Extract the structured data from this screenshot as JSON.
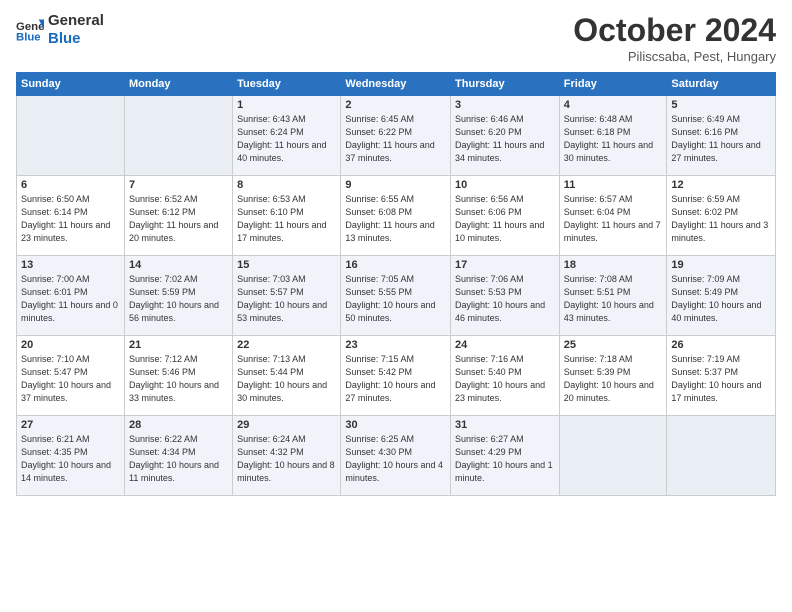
{
  "header": {
    "logo_line1": "General",
    "logo_line2": "Blue",
    "month": "October 2024",
    "location": "Piliscsaba, Pest, Hungary"
  },
  "weekdays": [
    "Sunday",
    "Monday",
    "Tuesday",
    "Wednesday",
    "Thursday",
    "Friday",
    "Saturday"
  ],
  "weeks": [
    [
      {
        "day": "",
        "info": ""
      },
      {
        "day": "",
        "info": ""
      },
      {
        "day": "1",
        "info": "Sunrise: 6:43 AM\nSunset: 6:24 PM\nDaylight: 11 hours and 40 minutes."
      },
      {
        "day": "2",
        "info": "Sunrise: 6:45 AM\nSunset: 6:22 PM\nDaylight: 11 hours and 37 minutes."
      },
      {
        "day": "3",
        "info": "Sunrise: 6:46 AM\nSunset: 6:20 PM\nDaylight: 11 hours and 34 minutes."
      },
      {
        "day": "4",
        "info": "Sunrise: 6:48 AM\nSunset: 6:18 PM\nDaylight: 11 hours and 30 minutes."
      },
      {
        "day": "5",
        "info": "Sunrise: 6:49 AM\nSunset: 6:16 PM\nDaylight: 11 hours and 27 minutes."
      }
    ],
    [
      {
        "day": "6",
        "info": "Sunrise: 6:50 AM\nSunset: 6:14 PM\nDaylight: 11 hours and 23 minutes."
      },
      {
        "day": "7",
        "info": "Sunrise: 6:52 AM\nSunset: 6:12 PM\nDaylight: 11 hours and 20 minutes."
      },
      {
        "day": "8",
        "info": "Sunrise: 6:53 AM\nSunset: 6:10 PM\nDaylight: 11 hours and 17 minutes."
      },
      {
        "day": "9",
        "info": "Sunrise: 6:55 AM\nSunset: 6:08 PM\nDaylight: 11 hours and 13 minutes."
      },
      {
        "day": "10",
        "info": "Sunrise: 6:56 AM\nSunset: 6:06 PM\nDaylight: 11 hours and 10 minutes."
      },
      {
        "day": "11",
        "info": "Sunrise: 6:57 AM\nSunset: 6:04 PM\nDaylight: 11 hours and 7 minutes."
      },
      {
        "day": "12",
        "info": "Sunrise: 6:59 AM\nSunset: 6:02 PM\nDaylight: 11 hours and 3 minutes."
      }
    ],
    [
      {
        "day": "13",
        "info": "Sunrise: 7:00 AM\nSunset: 6:01 PM\nDaylight: 11 hours and 0 minutes."
      },
      {
        "day": "14",
        "info": "Sunrise: 7:02 AM\nSunset: 5:59 PM\nDaylight: 10 hours and 56 minutes."
      },
      {
        "day": "15",
        "info": "Sunrise: 7:03 AM\nSunset: 5:57 PM\nDaylight: 10 hours and 53 minutes."
      },
      {
        "day": "16",
        "info": "Sunrise: 7:05 AM\nSunset: 5:55 PM\nDaylight: 10 hours and 50 minutes."
      },
      {
        "day": "17",
        "info": "Sunrise: 7:06 AM\nSunset: 5:53 PM\nDaylight: 10 hours and 46 minutes."
      },
      {
        "day": "18",
        "info": "Sunrise: 7:08 AM\nSunset: 5:51 PM\nDaylight: 10 hours and 43 minutes."
      },
      {
        "day": "19",
        "info": "Sunrise: 7:09 AM\nSunset: 5:49 PM\nDaylight: 10 hours and 40 minutes."
      }
    ],
    [
      {
        "day": "20",
        "info": "Sunrise: 7:10 AM\nSunset: 5:47 PM\nDaylight: 10 hours and 37 minutes."
      },
      {
        "day": "21",
        "info": "Sunrise: 7:12 AM\nSunset: 5:46 PM\nDaylight: 10 hours and 33 minutes."
      },
      {
        "day": "22",
        "info": "Sunrise: 7:13 AM\nSunset: 5:44 PM\nDaylight: 10 hours and 30 minutes."
      },
      {
        "day": "23",
        "info": "Sunrise: 7:15 AM\nSunset: 5:42 PM\nDaylight: 10 hours and 27 minutes."
      },
      {
        "day": "24",
        "info": "Sunrise: 7:16 AM\nSunset: 5:40 PM\nDaylight: 10 hours and 23 minutes."
      },
      {
        "day": "25",
        "info": "Sunrise: 7:18 AM\nSunset: 5:39 PM\nDaylight: 10 hours and 20 minutes."
      },
      {
        "day": "26",
        "info": "Sunrise: 7:19 AM\nSunset: 5:37 PM\nDaylight: 10 hours and 17 minutes."
      }
    ],
    [
      {
        "day": "27",
        "info": "Sunrise: 6:21 AM\nSunset: 4:35 PM\nDaylight: 10 hours and 14 minutes."
      },
      {
        "day": "28",
        "info": "Sunrise: 6:22 AM\nSunset: 4:34 PM\nDaylight: 10 hours and 11 minutes."
      },
      {
        "day": "29",
        "info": "Sunrise: 6:24 AM\nSunset: 4:32 PM\nDaylight: 10 hours and 8 minutes."
      },
      {
        "day": "30",
        "info": "Sunrise: 6:25 AM\nSunset: 4:30 PM\nDaylight: 10 hours and 4 minutes."
      },
      {
        "day": "31",
        "info": "Sunrise: 6:27 AM\nSunset: 4:29 PM\nDaylight: 10 hours and 1 minute."
      },
      {
        "day": "",
        "info": ""
      },
      {
        "day": "",
        "info": ""
      }
    ]
  ]
}
